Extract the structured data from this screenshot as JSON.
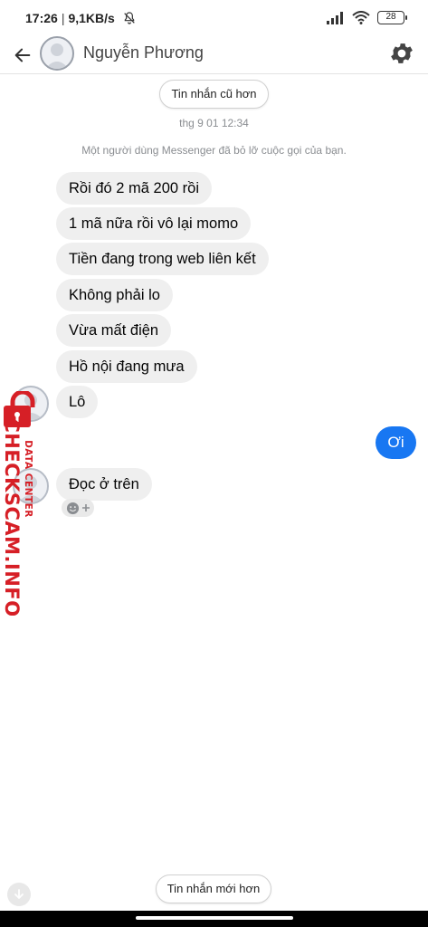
{
  "status_bar": {
    "time": "17:26",
    "separator": "|",
    "net_speed": "9,1KB/s",
    "battery": "28",
    "icons": [
      "bell-off-icon",
      "signal-icon",
      "wifi-icon",
      "battery-icon"
    ]
  },
  "header": {
    "contact_name": "Nguyễn Phương",
    "icons": [
      "back-arrow-icon",
      "avatar",
      "gear-icon"
    ]
  },
  "conversation": {
    "older_button": "Tin nhắn cũ hơn",
    "timestamp": "thg 9 01 12:34",
    "system_message": "Một người dùng Messenger đã bỏ lỡ cuộc gọi của bạn.",
    "incoming": [
      "Rồi đó 2 mã 200 rồi",
      "1 mã nữa rồi vô lại momo",
      "Tiền đang trong web liên kết",
      "Không phải lo",
      "Vừa mất điện",
      "Hồ nội đang mưa",
      "Lô"
    ],
    "outgoing": "Ơi",
    "last_incoming": "Đọc ở trên",
    "newer_button": "Tin nhắn mới hơn"
  },
  "watermark": {
    "main": "CHECKSCAM.INFO",
    "sub": "DATA CENTER"
  },
  "colors": {
    "accent": "#1877f2",
    "incoming_bubble": "#efefef",
    "watermark": "#d61f26"
  }
}
